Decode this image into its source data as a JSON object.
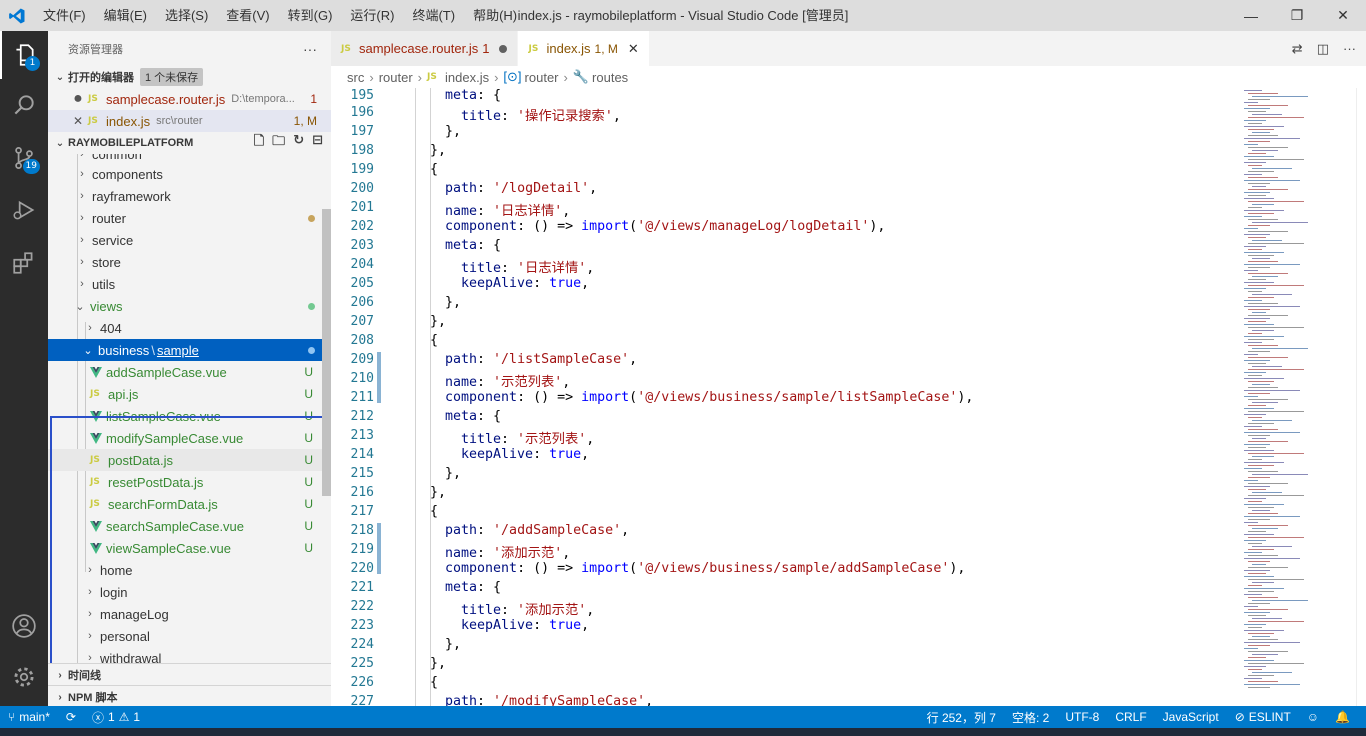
{
  "window": {
    "menu": [
      "文件(F)",
      "编辑(E)",
      "选择(S)",
      "查看(V)",
      "转到(G)",
      "运行(R)",
      "终端(T)",
      "帮助(H)"
    ],
    "title": "index.js - raymobileplatform - Visual Studio Code [管理员]"
  },
  "activity": {
    "explorer_badge": "1",
    "scm_badge": "19"
  },
  "sidebar": {
    "title": "资源管理器",
    "more": "···",
    "open_editors": {
      "label": "打开的编辑器",
      "tag": "1 个未保存"
    },
    "open_files": [
      {
        "name": "samplecase.router.js",
        "desc": "D:\\tempora...",
        "badge": "1"
      },
      {
        "name": "index.js",
        "desc": "src\\router",
        "badge": "1, M"
      }
    ],
    "project": "RAYMOBILEPLATFORM",
    "tree": [
      {
        "label": "common"
      },
      {
        "label": "components"
      },
      {
        "label": "rayframework"
      },
      {
        "label": "router"
      },
      {
        "label": "service"
      },
      {
        "label": "store"
      },
      {
        "label": "utils"
      },
      {
        "label": "views"
      },
      {
        "label": "404"
      },
      {
        "label": "business",
        "label2": "sample"
      },
      {
        "label": "addSampleCase.vue",
        "deco": "U"
      },
      {
        "label": "api.js",
        "deco": "U"
      },
      {
        "label": "listSampleCase.vue",
        "deco": "U"
      },
      {
        "label": "modifySampleCase.vue",
        "deco": "U"
      },
      {
        "label": "postData.js",
        "deco": "U"
      },
      {
        "label": "resetPostData.js",
        "deco": "U"
      },
      {
        "label": "searchFormData.js",
        "deco": "U"
      },
      {
        "label": "searchSampleCase.vue",
        "deco": "U"
      },
      {
        "label": "viewSampleCase.vue",
        "deco": "U"
      },
      {
        "label": "home"
      },
      {
        "label": "login"
      },
      {
        "label": "manageLog"
      },
      {
        "label": "personal"
      },
      {
        "label": "withdrawal"
      }
    ],
    "timeline": "时间线",
    "npm": "NPM 脚本"
  },
  "tabs": [
    {
      "name": "samplecase.router.js",
      "badge": "1"
    },
    {
      "name": "index.js",
      "badge": "1, M"
    }
  ],
  "breadcrumbs": [
    "src",
    "router",
    "index.js",
    "router",
    "routes"
  ],
  "code": {
    "line_numbers": [
      "195",
      "196",
      "197",
      "198",
      "199",
      "200",
      "201",
      "202",
      "203",
      "204",
      "205",
      "206",
      "207",
      "208",
      "209",
      "210",
      "211",
      "212",
      "213",
      "214",
      "215",
      "216",
      "217",
      "218",
      "219",
      "220",
      "221",
      "222",
      "223",
      "224",
      "225",
      "226",
      "227"
    ],
    "path_key": "path",
    "name_key": "name",
    "component_key": "component",
    "meta_key": "meta",
    "title_key": "title",
    "keepalive_key": "keepAlive",
    "arrow": "() =>",
    "import_kw": "import",
    "true_kw": "true",
    "lines": {
      "l195": "meta: {",
      "title1": "'操作记录搜索'",
      "path2": "'/logDetail'",
      "name2": "'日志详情'",
      "comp2": "'@/views/manageLog/logDetail'",
      "title2": "'日志详情'",
      "path3": "'/listSampleCase'",
      "name3": "'示范列表'",
      "comp3": "'@/views/business/sample/listSampleCase'",
      "title3": "'示范列表'",
      "path4": "'/addSampleCase'",
      "name4": "'添加示范'",
      "comp4": "'@/views/business/sample/addSampleCase'",
      "title4": "'添加示范'",
      "path5": "'/modifySampleCase'"
    }
  },
  "statusbar": {
    "branch": "main*",
    "errors": "1",
    "warnings": "1",
    "position": "行 252，列 7",
    "spaces": "空格: 2",
    "encoding": "UTF-8",
    "eol": "CRLF",
    "language": "JavaScript",
    "eslint": "ESLINT"
  }
}
